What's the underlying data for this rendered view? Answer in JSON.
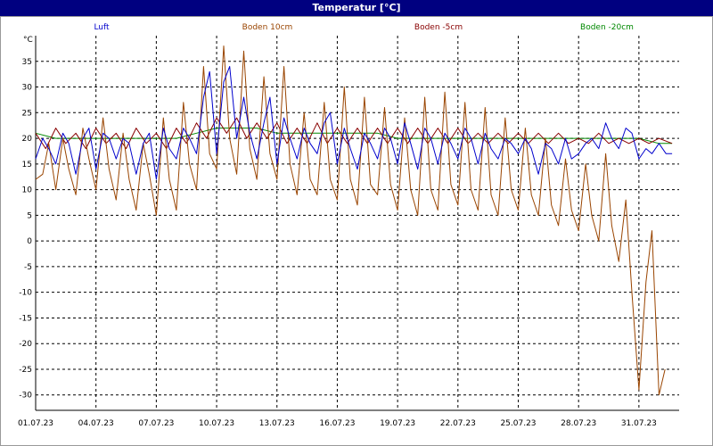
{
  "window": {
    "title": "Temperatur [°C]"
  },
  "chart_data": {
    "type": "line",
    "title": "Temperatur [°C]",
    "ylabel": "°C",
    "xlabel": "",
    "ylim": [
      -33,
      40
    ],
    "xlim": [
      0,
      32
    ],
    "grid": true,
    "legend_placement": "top",
    "yticks": [
      35,
      30,
      25,
      20,
      15,
      10,
      5,
      0,
      -5,
      -10,
      -15,
      -20,
      -25,
      -30
    ],
    "xticks": [
      {
        "x": 0,
        "label": "01.07.23"
      },
      {
        "x": 3,
        "label": "04.07.23"
      },
      {
        "x": 6,
        "label": "07.07.23"
      },
      {
        "x": 9,
        "label": "10.07.23"
      },
      {
        "x": 12,
        "label": "13.07.23"
      },
      {
        "x": 15,
        "label": "16.07.23"
      },
      {
        "x": 18,
        "label": "19.07.23"
      },
      {
        "x": 21,
        "label": "22.07.23"
      },
      {
        "x": 24,
        "label": "25.07.23"
      },
      {
        "x": 27,
        "label": "28.07.23"
      },
      {
        "x": 30,
        "label": "31.07.23"
      }
    ],
    "series": [
      {
        "name": "Luft",
        "color": "#0000cc",
        "values": [
          [
            0,
            16
          ],
          [
            0.35,
            20
          ],
          [
            0.65,
            18
          ],
          [
            1,
            15
          ],
          [
            1.35,
            21
          ],
          [
            1.65,
            19
          ],
          [
            2,
            13
          ],
          [
            2.35,
            20
          ],
          [
            2.65,
            22
          ],
          [
            3,
            14
          ],
          [
            3.35,
            21
          ],
          [
            3.65,
            20
          ],
          [
            4,
            16
          ],
          [
            4.35,
            20
          ],
          [
            4.65,
            19
          ],
          [
            5,
            13
          ],
          [
            5.35,
            19
          ],
          [
            5.65,
            21
          ],
          [
            6,
            12
          ],
          [
            6.35,
            22
          ],
          [
            6.65,
            18
          ],
          [
            7,
            16
          ],
          [
            7.35,
            22
          ],
          [
            7.65,
            20
          ],
          [
            8,
            17
          ],
          [
            8.35,
            28
          ],
          [
            8.65,
            33
          ],
          [
            9,
            17
          ],
          [
            9.35,
            31
          ],
          [
            9.65,
            34
          ],
          [
            10,
            20
          ],
          [
            10.35,
            28
          ],
          [
            10.65,
            21
          ],
          [
            11,
            16
          ],
          [
            11.35,
            23
          ],
          [
            11.65,
            28
          ],
          [
            12,
            15
          ],
          [
            12.35,
            24
          ],
          [
            12.65,
            20
          ],
          [
            13,
            16
          ],
          [
            13.35,
            22
          ],
          [
            13.65,
            19
          ],
          [
            14,
            17
          ],
          [
            14.35,
            23
          ],
          [
            14.65,
            25
          ],
          [
            15,
            15
          ],
          [
            15.35,
            22
          ],
          [
            15.65,
            18
          ],
          [
            16,
            14
          ],
          [
            16.35,
            21
          ],
          [
            16.65,
            19
          ],
          [
            17,
            16
          ],
          [
            17.35,
            22
          ],
          [
            17.65,
            20
          ],
          [
            18,
            15
          ],
          [
            18.35,
            23
          ],
          [
            18.65,
            19
          ],
          [
            19,
            14
          ],
          [
            19.35,
            22
          ],
          [
            19.65,
            20
          ],
          [
            20,
            15
          ],
          [
            20.35,
            21
          ],
          [
            20.65,
            19
          ],
          [
            21,
            16
          ],
          [
            21.35,
            22
          ],
          [
            21.65,
            20
          ],
          [
            22,
            15
          ],
          [
            22.35,
            21
          ],
          [
            22.65,
            18
          ],
          [
            23,
            16
          ],
          [
            23.35,
            20
          ],
          [
            23.65,
            19
          ],
          [
            24,
            17
          ],
          [
            24.35,
            20
          ],
          [
            24.65,
            18
          ],
          [
            25,
            13
          ],
          [
            25.35,
            19
          ],
          [
            25.65,
            18
          ],
          [
            26,
            15
          ],
          [
            26.35,
            20
          ],
          [
            26.65,
            16
          ],
          [
            27,
            17
          ],
          [
            27.35,
            19
          ],
          [
            27.65,
            20
          ],
          [
            28,
            18
          ],
          [
            28.35,
            23
          ],
          [
            28.65,
            20
          ],
          [
            29,
            18
          ],
          [
            29.35,
            22
          ],
          [
            29.65,
            21
          ],
          [
            30,
            16
          ],
          [
            30.35,
            18
          ],
          [
            30.65,
            17
          ],
          [
            31,
            19
          ],
          [
            31.35,
            17
          ],
          [
            31.65,
            17
          ]
        ]
      },
      {
        "name": "Boden 10cm",
        "color": "#994400",
        "values": [
          [
            0,
            12
          ],
          [
            0.35,
            13
          ],
          [
            0.65,
            19
          ],
          [
            1,
            10
          ],
          [
            1.35,
            20
          ],
          [
            1.65,
            14
          ],
          [
            2,
            9
          ],
          [
            2.35,
            22
          ],
          [
            2.65,
            16
          ],
          [
            3,
            10
          ],
          [
            3.35,
            24
          ],
          [
            3.65,
            14
          ],
          [
            4,
            8
          ],
          [
            4.35,
            21
          ],
          [
            4.65,
            12
          ],
          [
            5,
            6
          ],
          [
            5.35,
            19
          ],
          [
            5.65,
            13
          ],
          [
            6,
            5
          ],
          [
            6.35,
            24
          ],
          [
            6.65,
            12
          ],
          [
            7,
            6
          ],
          [
            7.35,
            27
          ],
          [
            7.65,
            15
          ],
          [
            8,
            10
          ],
          [
            8.35,
            34
          ],
          [
            8.65,
            17
          ],
          [
            9,
            14
          ],
          [
            9.35,
            38
          ],
          [
            9.65,
            20
          ],
          [
            10,
            13
          ],
          [
            10.35,
            37
          ],
          [
            10.65,
            18
          ],
          [
            11,
            12
          ],
          [
            11.35,
            32
          ],
          [
            11.65,
            17
          ],
          [
            12,
            12
          ],
          [
            12.35,
            34
          ],
          [
            12.65,
            15
          ],
          [
            13,
            9
          ],
          [
            13.35,
            25
          ],
          [
            13.65,
            12
          ],
          [
            14,
            9
          ],
          [
            14.35,
            27
          ],
          [
            14.65,
            12
          ],
          [
            15,
            8
          ],
          [
            15.35,
            30
          ],
          [
            15.65,
            12
          ],
          [
            16,
            7
          ],
          [
            16.35,
            28
          ],
          [
            16.65,
            11
          ],
          [
            17,
            9
          ],
          [
            17.35,
            26
          ],
          [
            17.65,
            11
          ],
          [
            18,
            6
          ],
          [
            18.35,
            24
          ],
          [
            18.65,
            10
          ],
          [
            19,
            5
          ],
          [
            19.35,
            28
          ],
          [
            19.65,
            10
          ],
          [
            20,
            6
          ],
          [
            20.35,
            29
          ],
          [
            20.65,
            11
          ],
          [
            21,
            7
          ],
          [
            21.35,
            27
          ],
          [
            21.65,
            10
          ],
          [
            22,
            6
          ],
          [
            22.35,
            26
          ],
          [
            22.65,
            9
          ],
          [
            23,
            5
          ],
          [
            23.35,
            24
          ],
          [
            23.65,
            10
          ],
          [
            24,
            6
          ],
          [
            24.35,
            22
          ],
          [
            24.65,
            9
          ],
          [
            25,
            5
          ],
          [
            25.35,
            20
          ],
          [
            25.65,
            7
          ],
          [
            26,
            3
          ],
          [
            26.35,
            16
          ],
          [
            26.65,
            6
          ],
          [
            27,
            2
          ],
          [
            27.35,
            15
          ],
          [
            27.65,
            5
          ],
          [
            28,
            0
          ],
          [
            28.35,
            17
          ],
          [
            28.65,
            3
          ],
          [
            29,
            -4
          ],
          [
            29.35,
            8
          ],
          [
            29.65,
            -10
          ],
          [
            30,
            -29
          ],
          [
            30.35,
            -8
          ],
          [
            30.65,
            2
          ],
          [
            31,
            -30
          ],
          [
            31.3,
            -25
          ]
        ]
      },
      {
        "name": "Boden -5cm",
        "color": "#880000",
        "values": [
          [
            0,
            21
          ],
          [
            0.5,
            18
          ],
          [
            1,
            22
          ],
          [
            1.5,
            19
          ],
          [
            2,
            21
          ],
          [
            2.5,
            18
          ],
          [
            3,
            22
          ],
          [
            3.5,
            19
          ],
          [
            4,
            21
          ],
          [
            4.5,
            18
          ],
          [
            5,
            22
          ],
          [
            5.5,
            19
          ],
          [
            6,
            21
          ],
          [
            6.5,
            18
          ],
          [
            7,
            22
          ],
          [
            7.5,
            19
          ],
          [
            8,
            23
          ],
          [
            8.5,
            20
          ],
          [
            9,
            24
          ],
          [
            9.5,
            21
          ],
          [
            10,
            24
          ],
          [
            10.5,
            20
          ],
          [
            11,
            23
          ],
          [
            11.5,
            20
          ],
          [
            12,
            23
          ],
          [
            12.5,
            19
          ],
          [
            13,
            22
          ],
          [
            13.5,
            19
          ],
          [
            14,
            23
          ],
          [
            14.5,
            19
          ],
          [
            15,
            22
          ],
          [
            15.5,
            19
          ],
          [
            16,
            22
          ],
          [
            16.5,
            19
          ],
          [
            17,
            22
          ],
          [
            17.5,
            19
          ],
          [
            18,
            22
          ],
          [
            18.5,
            19
          ],
          [
            19,
            22
          ],
          [
            19.5,
            19
          ],
          [
            20,
            22
          ],
          [
            20.5,
            19
          ],
          [
            21,
            22
          ],
          [
            21.5,
            19
          ],
          [
            22,
            21
          ],
          [
            22.5,
            19
          ],
          [
            23,
            21
          ],
          [
            23.5,
            19
          ],
          [
            24,
            21
          ],
          [
            24.5,
            19
          ],
          [
            25,
            21
          ],
          [
            25.5,
            19
          ],
          [
            26,
            21
          ],
          [
            26.5,
            19
          ],
          [
            27,
            20
          ],
          [
            27.5,
            19
          ],
          [
            28,
            21
          ],
          [
            28.5,
            19
          ],
          [
            29,
            20
          ],
          [
            29.5,
            19
          ],
          [
            30,
            20
          ],
          [
            30.5,
            19
          ],
          [
            31,
            20
          ],
          [
            31.65,
            19
          ]
        ]
      },
      {
        "name": "Boden -20cm",
        "color": "#008800",
        "values": [
          [
            0,
            21
          ],
          [
            1,
            20
          ],
          [
            2,
            20
          ],
          [
            3,
            20
          ],
          [
            4,
            20
          ],
          [
            5,
            20
          ],
          [
            6,
            20
          ],
          [
            7,
            20
          ],
          [
            8,
            21
          ],
          [
            9,
            22
          ],
          [
            10,
            22
          ],
          [
            11,
            22
          ],
          [
            12,
            21
          ],
          [
            13,
            21
          ],
          [
            14,
            21
          ],
          [
            15,
            21
          ],
          [
            16,
            21
          ],
          [
            17,
            21
          ],
          [
            18,
            20
          ],
          [
            19,
            20
          ],
          [
            20,
            20
          ],
          [
            21,
            20
          ],
          [
            22,
            20
          ],
          [
            23,
            20
          ],
          [
            24,
            20
          ],
          [
            25,
            20
          ],
          [
            26,
            20
          ],
          [
            27,
            20
          ],
          [
            28,
            20
          ],
          [
            29,
            20
          ],
          [
            30,
            20
          ],
          [
            31,
            19
          ],
          [
            31.65,
            19
          ]
        ]
      }
    ]
  }
}
